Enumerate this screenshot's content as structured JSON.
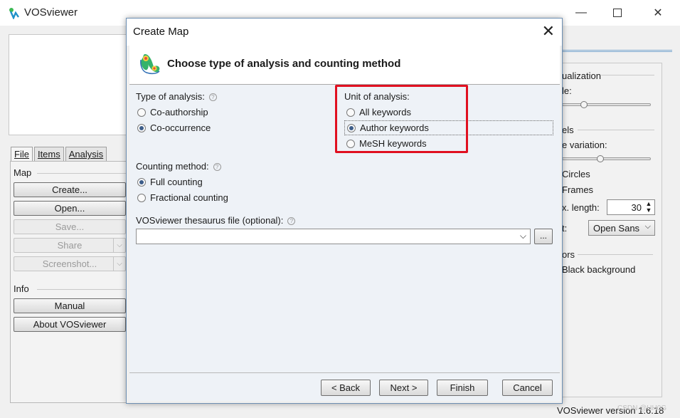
{
  "app": {
    "title": "VOSviewer",
    "version_text": "VOSviewer version 1.6.18",
    "watermark": "CSDN @HH0G"
  },
  "left": {
    "tabs": [
      {
        "label": "File",
        "active": true
      },
      {
        "label": "Items",
        "active": false
      },
      {
        "label": "Analysis",
        "active": false
      }
    ],
    "map_group": "Map",
    "info_group": "Info",
    "buttons": {
      "create": "Create...",
      "open": "Open...",
      "save": "Save...",
      "share": "Share",
      "screenshot": "Screenshot...",
      "manual": "Manual",
      "about": "About VOSviewer"
    }
  },
  "right": {
    "visualization_label": "ualization",
    "scale_label": "le:",
    "labels_group": "els",
    "size_variation_label": "e variation:",
    "circles_label": "Circles",
    "frames_label": "Frames",
    "max_length_label": "x. length:",
    "max_length_value": "30",
    "font_label": "t:",
    "font_value": "Open Sans",
    "colors_group": "ors",
    "black_bg_label": "Black background"
  },
  "dialog": {
    "title": "Create Map",
    "header_title": "Choose type of analysis and counting method",
    "type_label": "Type of analysis:",
    "type_options": [
      {
        "label": "Co-authorship",
        "checked": false
      },
      {
        "label": "Co-occurrence",
        "checked": true
      }
    ],
    "unit_label": "Unit of analysis:",
    "unit_options": [
      {
        "label": "All keywords",
        "checked": false
      },
      {
        "label": "Author keywords",
        "checked": true
      },
      {
        "label": "MeSH keywords",
        "checked": false
      }
    ],
    "counting_label": "Counting method:",
    "counting_options": [
      {
        "label": "Full counting",
        "checked": true
      },
      {
        "label": "Fractional counting",
        "checked": false
      }
    ],
    "thesaurus_label": "VOSviewer thesaurus file (optional):",
    "thesaurus_value": "",
    "browse_label": "...",
    "buttons": {
      "back": "< Back",
      "next": "Next >",
      "finish": "Finish",
      "cancel": "Cancel"
    },
    "highlight_color": "#e01020"
  }
}
